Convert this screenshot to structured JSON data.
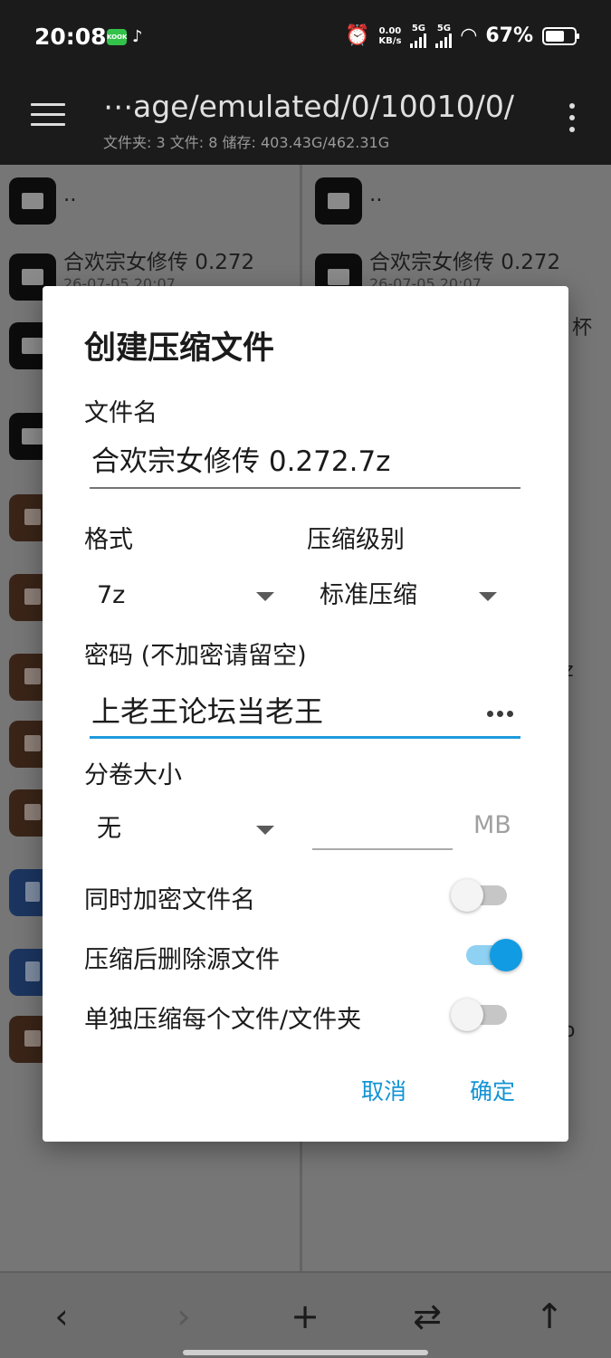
{
  "status_bar": {
    "time": "20:08",
    "net_speed_value": "0.00",
    "net_speed_unit": "KB/s",
    "signal1": "5G",
    "signal2": "5G",
    "battery": "67%",
    "battery_level": 0.67
  },
  "app_bar": {
    "path": "⋯age/emulated/0/10010/0/",
    "stats": "文件夹: 3  文件: 8  储存: 403.43G/462.31G"
  },
  "left_pane": {
    "items": [
      {
        "name": "..",
        "date": ""
      },
      {
        "name": "合欢宗女修传 0.272",
        "date": "26-07-05 20:07"
      }
    ]
  },
  "right_pane": {
    "items": [
      {
        "name": "..",
        "date": ""
      },
      {
        "name": "合欢宗女修传 0.272",
        "date": "26-07-05 20:07"
      }
    ],
    "fragments": [
      "杯",
      "z",
      "o"
    ]
  },
  "dialog": {
    "title": "创建压缩文件",
    "filename_label": "文件名",
    "filename_value": "合欢宗女修传 0.272.7z",
    "format_label": "格式",
    "format_value": "7z",
    "level_label": "压缩级别",
    "level_value": "标准压缩",
    "password_label": "密码 (不加密请留空)",
    "password_value": "上老王论坛当老王",
    "volume_label": "分卷大小",
    "volume_value": "无",
    "volume_unit": "MB",
    "encrypt_names_label": "同时加密文件名",
    "encrypt_names_on": false,
    "delete_source_label": "压缩后删除源文件",
    "delete_source_on": true,
    "separate_label": "单独压缩每个文件/文件夹",
    "separate_on": false,
    "cancel_label": "取消",
    "ok_label": "确定"
  },
  "bottom_bar": {
    "back": "‹",
    "forward": "›",
    "add": "+",
    "swap": "⇄",
    "up": "↑"
  },
  "colors": {
    "accent": "#1494d5",
    "toggle_on": "#119be2",
    "bar_bg": "#1b1b1b"
  }
}
